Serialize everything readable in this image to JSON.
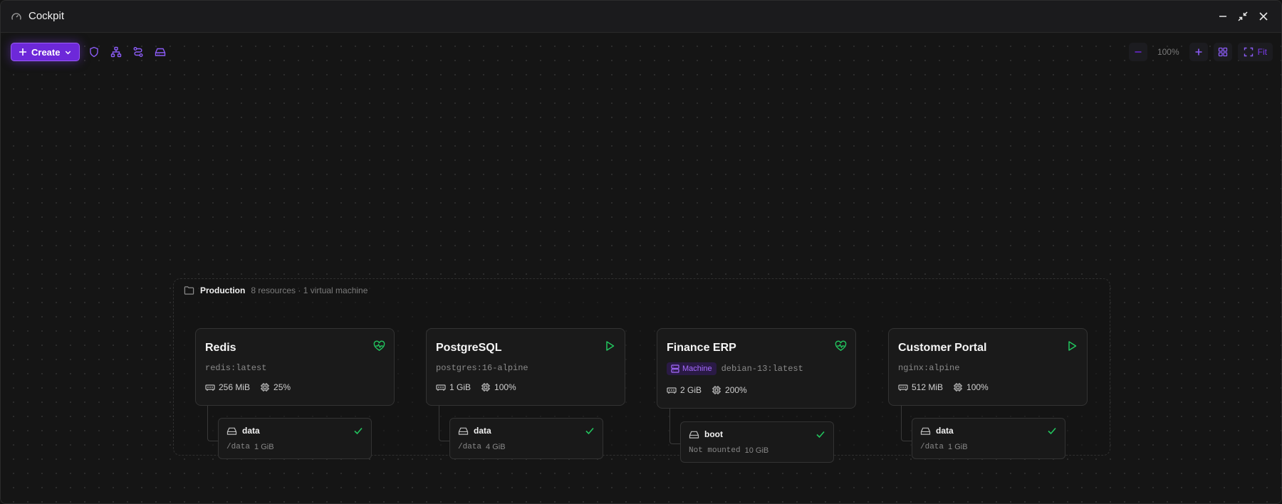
{
  "window": {
    "title": "Cockpit"
  },
  "toolbar": {
    "create_label": "Create",
    "zoom_level": "100%",
    "fit_label": "Fit"
  },
  "group": {
    "name": "Production",
    "meta": "8 resources · 1 virtual machine"
  },
  "cards": [
    {
      "name": "Redis",
      "image": "redis:latest",
      "memory": "256 MiB",
      "cpu": "25%",
      "status": "healthy-heart-icon"
    },
    {
      "name": "PostgreSQL",
      "image": "postgres:16-alpine",
      "memory": "1 GiB",
      "cpu": "100%",
      "status": "running-play-icon"
    },
    {
      "name": "Finance ERP",
      "badge": "Machine",
      "image": "debian-13:latest",
      "memory": "2 GiB",
      "cpu": "200%",
      "status": "healthy-heart-icon"
    },
    {
      "name": "Customer Portal",
      "image": "nginx:alpine",
      "memory": "512 MiB",
      "cpu": "100%",
      "status": "running-play-icon"
    }
  ],
  "volumes": [
    {
      "name": "data",
      "mount": "/data",
      "size": "1 GiB"
    },
    {
      "name": "data",
      "mount": "/data",
      "size": "4 GiB"
    },
    {
      "name": "boot",
      "mount": "Not mounted",
      "size": "10 GiB"
    },
    {
      "name": "data",
      "mount": "/data",
      "size": "1 GiB"
    }
  ],
  "colors": {
    "accent": "#7c3aed",
    "healthy": "#22c55e",
    "background": "#151515"
  }
}
